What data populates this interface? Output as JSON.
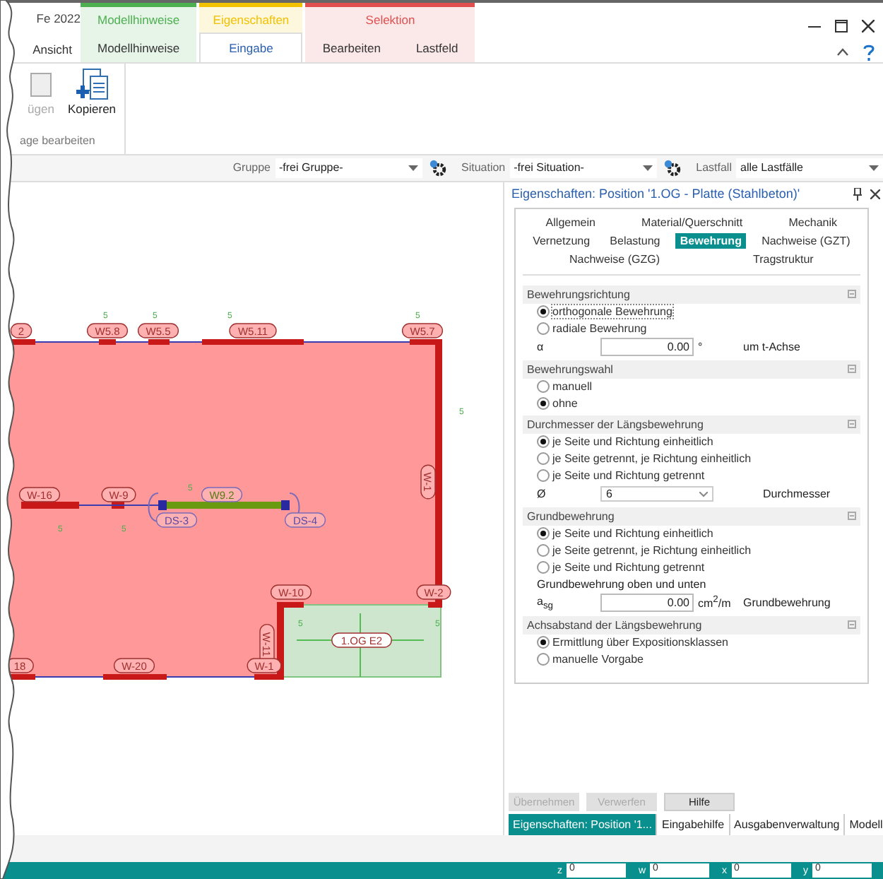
{
  "app_title": "Fe 2022",
  "tabs": [
    {
      "label": "Ansicht",
      "selected": false
    }
  ],
  "context_groups": [
    {
      "name": "Modellhinweise",
      "color": "#4caf50",
      "tabs": [
        {
          "label": "Modellhinweise",
          "selected": false
        }
      ]
    },
    {
      "name": "Eigenschaften",
      "color": "#f2c200",
      "tabs": [
        {
          "label": "Eingabe",
          "selected": true
        }
      ]
    },
    {
      "name": "Selektion",
      "color": "#e05050",
      "tabs": [
        {
          "label": "Bearbeiten",
          "selected": false
        },
        {
          "label": "Lastfeld",
          "selected": false
        }
      ]
    }
  ],
  "ribbon": {
    "buttons": [
      {
        "label": "ügen",
        "disabled": true
      },
      {
        "label": "Kopieren",
        "disabled": false
      }
    ],
    "group_label": "age bearbeiten"
  },
  "toolbar": [
    {
      "label": "Gruppe",
      "value": "-frei Gruppe-",
      "gear": true
    },
    {
      "label": "Situation",
      "value": "-frei Situation-",
      "gear": true
    },
    {
      "label": "Lastfall",
      "value": "alle Lastfälle",
      "gear": false
    }
  ],
  "plan": {
    "labels": [
      "2",
      "W5.8",
      "W5.5",
      "W5.11",
      "W5.7",
      "W-1",
      "W-16",
      "W-9",
      "W9.2",
      "DS-3",
      "DS-4",
      "W-10",
      "W-2",
      "W-11",
      "1.OG E2",
      "18",
      "W-20",
      "W-1"
    ],
    "marks": [
      "5",
      "5",
      "5",
      "5",
      "5",
      "5",
      "5",
      "5",
      "5",
      "5"
    ]
  },
  "panel": {
    "title": "Eigenschaften: Position '1.OG - Platte (Stahlbeton)'",
    "tab_rows": [
      [
        {
          "label": "Allgemein",
          "selected": false
        },
        {
          "label": "Material/Querschnitt",
          "selected": false
        },
        {
          "label": "Mechanik",
          "selected": false
        }
      ],
      [
        {
          "label": "Vernetzung",
          "selected": false
        },
        {
          "label": "Belastung",
          "selected": false
        },
        {
          "label": "Bewehrung",
          "selected": true
        },
        {
          "label": "Nachweise (GZT)",
          "selected": false
        }
      ],
      [
        {
          "label": "Nachweise (GZG)",
          "selected": false
        },
        {
          "label": "Tragstruktur",
          "selected": false
        }
      ]
    ],
    "sections": [
      {
        "title": "Bewehrungsrichtung",
        "items": [
          {
            "kind": "radio",
            "label": "orthogonale Bewehrung",
            "selected": true
          },
          {
            "kind": "radio",
            "label": "radiale Bewehrung",
            "selected": false
          },
          {
            "kind": "field",
            "label": "α",
            "value": "0.00",
            "unit": "°",
            "description": "um t-Achse"
          }
        ]
      },
      {
        "title": "Bewehrungswahl",
        "items": [
          {
            "kind": "radio",
            "label": "manuell",
            "selected": false
          },
          {
            "kind": "radio",
            "label": "ohne",
            "selected": true
          }
        ]
      },
      {
        "title": "Durchmesser der Längsbewehrung",
        "items": [
          {
            "kind": "radio",
            "label": "je Seite und Richtung einheitlich",
            "selected": true
          },
          {
            "kind": "radio",
            "label": "je Seite getrennt, je Richtung einheitlich",
            "selected": false
          },
          {
            "kind": "radio",
            "label": "je Seite und Richtung getrennt",
            "selected": false
          },
          {
            "kind": "select",
            "label": "Ø",
            "value": "6",
            "description": "Durchmesser"
          }
        ]
      },
      {
        "title": "Grundbewehrung",
        "items": [
          {
            "kind": "radio",
            "label": "je Seite und Richtung einheitlich",
            "selected": true
          },
          {
            "kind": "radio",
            "label": "je Seite getrennt, je Richtung einheitlich",
            "selected": false
          },
          {
            "kind": "radio",
            "label": "je Seite und Richtung getrennt",
            "selected": false
          },
          {
            "kind": "text",
            "label": "Grundbewehrung oben und unten"
          },
          {
            "kind": "field",
            "label": "a$_{sg}$",
            "value": "0.00",
            "unit": "cm$^{2}$/m",
            "description": "Grundbewehrung"
          }
        ]
      },
      {
        "title": "Achsabstand der Längsbewehrung",
        "items": [
          {
            "kind": "radio",
            "label": "Ermittlung über Expositionsklassen",
            "selected": true
          },
          {
            "kind": "radio",
            "label": "manuelle Vorgabe",
            "selected": false
          }
        ]
      }
    ],
    "buttons": [
      {
        "label": "Übernehmen",
        "disabled": true
      },
      {
        "label": "Verwerfen",
        "disabled": true
      },
      {
        "label": "Hilfe",
        "disabled": false
      }
    ],
    "bottom_tabs": [
      {
        "label": "Eigenschaften: Position '1...",
        "selected": true
      },
      {
        "label": "Eingabehilfe",
        "selected": false
      },
      {
        "label": "Ausgabenverwaltung",
        "selected": false
      },
      {
        "label": "Modell",
        "selected": false
      }
    ]
  },
  "status_fields": [
    {
      "label": "z",
      "value": "0"
    },
    {
      "label": "w",
      "value": "0"
    },
    {
      "label": "x",
      "value": "0"
    },
    {
      "label": "y",
      "value": "0"
    }
  ]
}
